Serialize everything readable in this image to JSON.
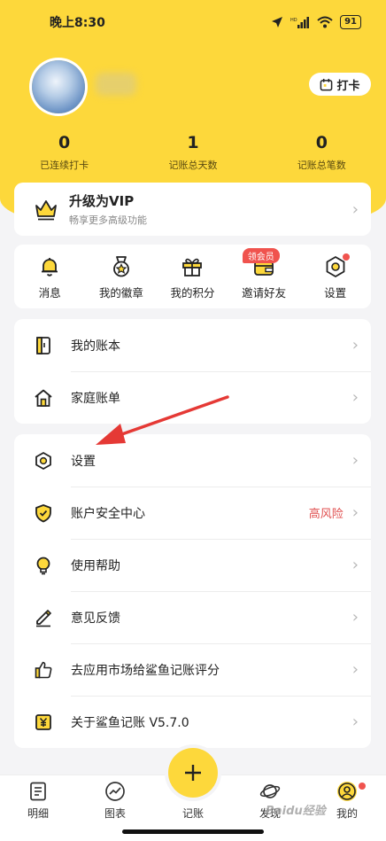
{
  "status": {
    "time": "晚上8:30",
    "battery": "91",
    "network": "HD"
  },
  "profile": {
    "checkin_label": "打卡"
  },
  "stats": [
    {
      "value": "0",
      "label": "已连续打卡"
    },
    {
      "value": "1",
      "label": "记账总天数"
    },
    {
      "value": "0",
      "label": "记账总笔数"
    }
  ],
  "vip": {
    "title": "升级为VIP",
    "subtitle": "畅享更多高级功能"
  },
  "quick": [
    {
      "label": "消息"
    },
    {
      "label": "我的徽章"
    },
    {
      "label": "我的积分"
    },
    {
      "label": "邀请好友",
      "badge": "领会员"
    },
    {
      "label": "设置"
    }
  ],
  "list1": [
    {
      "label": "我的账本"
    },
    {
      "label": "家庭账单"
    }
  ],
  "list2": [
    {
      "label": "设置"
    },
    {
      "label": "账户安全中心",
      "extra": "高风险"
    },
    {
      "label": "使用帮助"
    },
    {
      "label": "意见反馈"
    },
    {
      "label": "去应用市场给鲨鱼记账评分"
    },
    {
      "label": "关于鲨鱼记账 V5.7.0"
    }
  ],
  "tabs": [
    {
      "label": "明细"
    },
    {
      "label": "图表"
    },
    {
      "label": "记账"
    },
    {
      "label": "发现"
    },
    {
      "label": "我的"
    }
  ],
  "watermark": "Baidu经验",
  "colors": {
    "accent": "#fdd83b",
    "danger": "#e05050",
    "arrow": "#e53935"
  }
}
